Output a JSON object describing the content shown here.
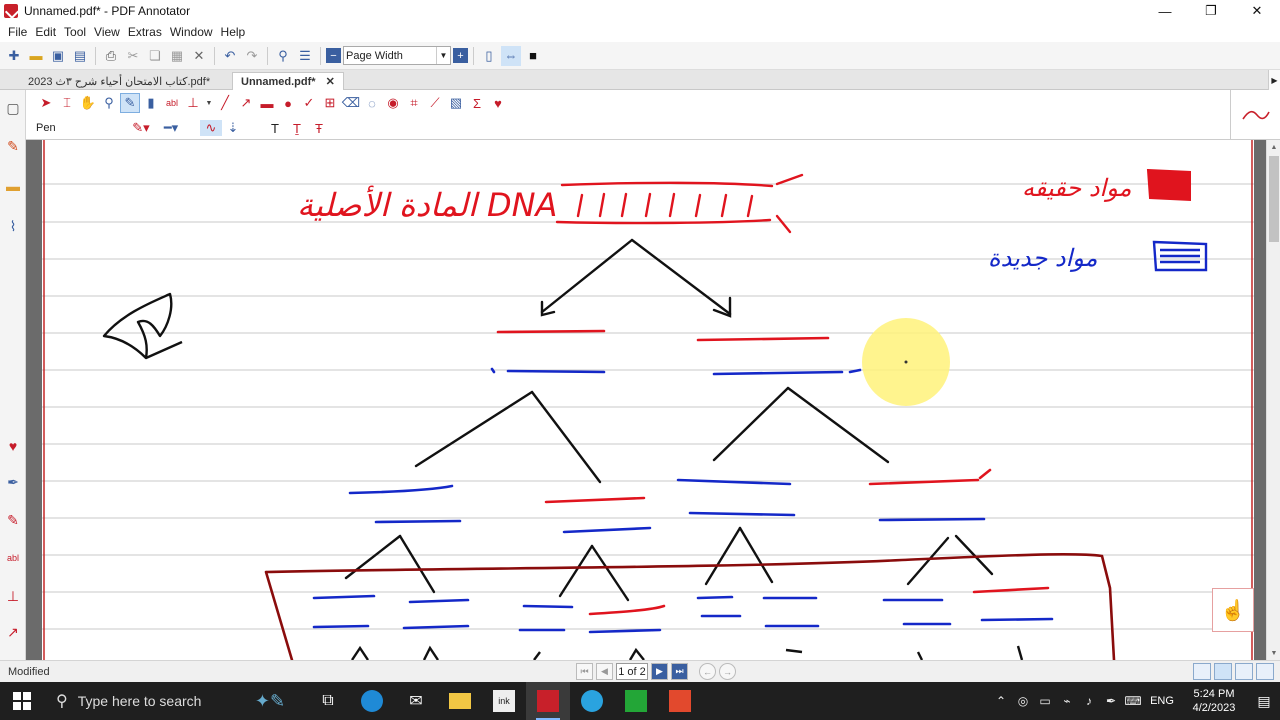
{
  "window": {
    "title": "Unnamed.pdf* - PDF Annotator",
    "minimize": "—",
    "restore": "❐",
    "close": "✕"
  },
  "menu": [
    "File",
    "Edit",
    "Tool",
    "View",
    "Extras",
    "Window",
    "Help"
  ],
  "toolbar": {
    "zoom_value": "Page Width"
  },
  "tabs": {
    "inactive_label": "كتاب الامتحان أحياء شرح ٣ث 2023.pdf*",
    "active_label": "Unnamed.pdf*",
    "close_glyph": "✕"
  },
  "pen_tool": {
    "label": "Pen"
  },
  "document": {
    "handwriting": {
      "red_title": "المادة الأصلية DNA",
      "red_legend": "مواد حقيقه",
      "blue_legend": "مواد جديدة"
    }
  },
  "status": {
    "text": "Modified",
    "page_indicator": "1 of 2"
  },
  "taskbar": {
    "search_placeholder": "Type here to search",
    "language": "ENG",
    "time": "5:24 PM",
    "date": "4/2/2023"
  },
  "colors": {
    "accent": "#c8202a",
    "ink_red": "#e0141e",
    "ink_blue": "#1428c8",
    "ink_black": "#111111",
    "ink_darkred": "#8a0c0c",
    "highlight": "#fff27a"
  }
}
